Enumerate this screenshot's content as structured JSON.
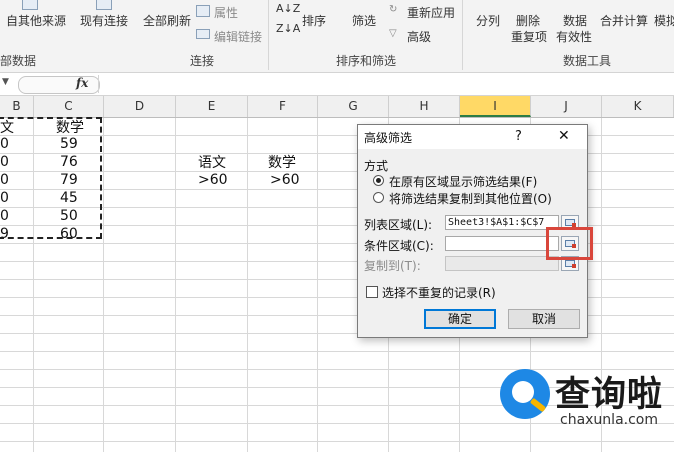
{
  "ribbon": {
    "from_other_sources": "自其他来源",
    "existing_connections": "现有连接",
    "refresh_all": "全部刷新",
    "properties": "属性",
    "edit_links": "编辑链接",
    "sort": "排序",
    "filter": "筛选",
    "reapply": "重新应用",
    "advanced": "高级",
    "text_to_columns": "分列",
    "remove_duplicates_1": "删除",
    "remove_duplicates_2": "重复项",
    "data_validation_1": "数据",
    "data_validation_2": "有效性",
    "consolidate": "合并计算",
    "what_if": "模拟",
    "group_external": "部数据",
    "group_connections": "连接",
    "group_sort_filter": "排序和筛选",
    "group_data_tools": "数据工具"
  },
  "formula_bar": {
    "fx_label": "fx",
    "value": ""
  },
  "columns": [
    "B",
    "C",
    "D",
    "E",
    "F",
    "G",
    "H",
    "I",
    "J",
    "K"
  ],
  "selected_column": "I",
  "sheet": {
    "col_b": [
      "文",
      "0",
      "0",
      "0",
      "0",
      "0",
      "9"
    ],
    "col_c": [
      "数学",
      "59",
      "76",
      "79",
      "45",
      "50",
      "60"
    ],
    "criteria_headers": [
      "语文",
      "数学"
    ],
    "criteria_values": [
      ">60",
      ">60"
    ]
  },
  "dialog": {
    "title": "高级筛选",
    "help": "?",
    "close": "✕",
    "mode_label": "方式",
    "option_in_place": "在原有区域显示筛选结果(F)",
    "option_copy": "将筛选结果复制到其他位置(O)",
    "list_range_label": "列表区域(L):",
    "list_range_value": "Sheet3!$A$1:$C$7",
    "criteria_range_label": "条件区域(C):",
    "criteria_range_value": "",
    "copy_to_label": "复制到(T):",
    "copy_to_value": "",
    "unique_label": "选择不重复的记录(R)",
    "ok": "确定",
    "cancel": "取消"
  },
  "watermark": {
    "brand": "查询啦",
    "url": "chaxunla.com"
  }
}
